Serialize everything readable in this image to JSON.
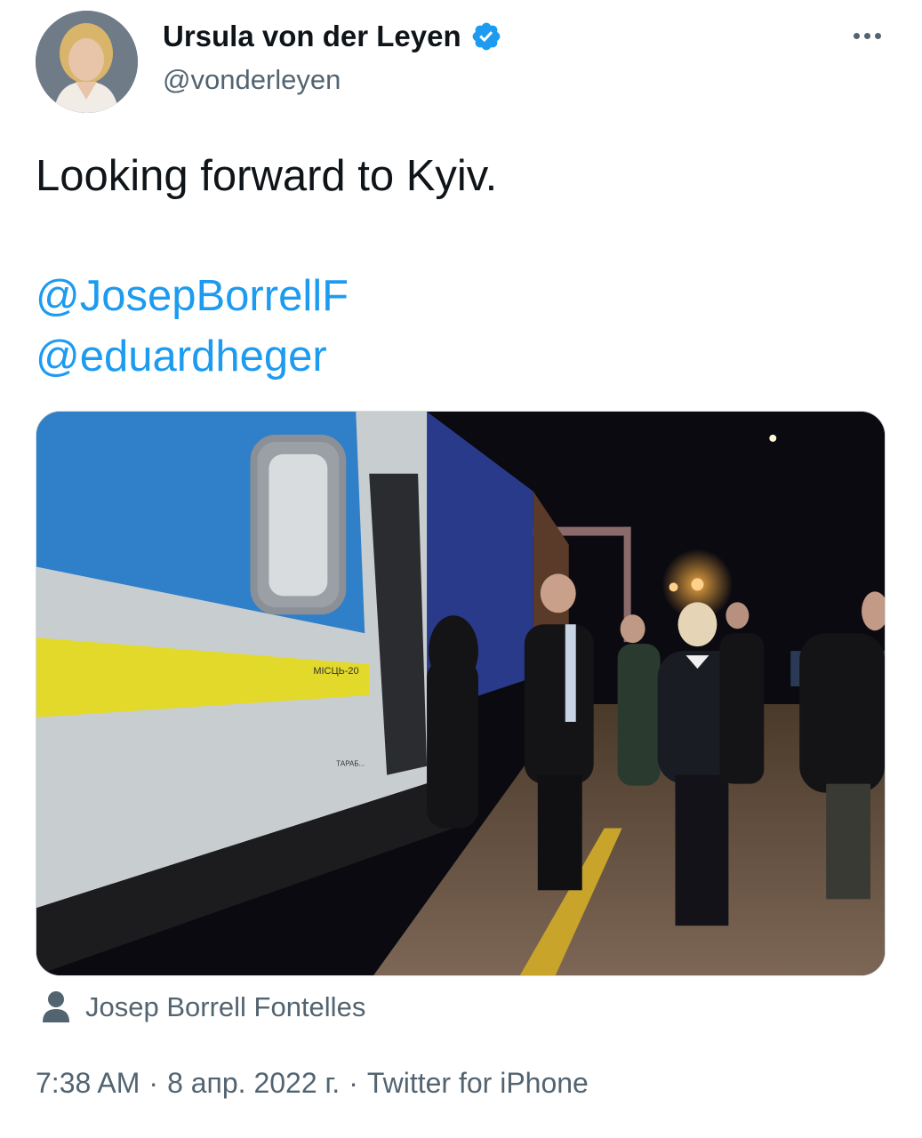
{
  "author": {
    "display_name": "Ursula von der Leyen",
    "handle": "@vonderleyen",
    "verified_icon": "verified-badge",
    "verified_color": "#1d9bf0"
  },
  "menu_icon": "more-horizontal-icon",
  "tweet": {
    "text": "Looking forward to Kyiv.",
    "mentions": [
      "@JosepBorrellF",
      "@eduardheger"
    ],
    "link_color": "#1d9bf0"
  },
  "media": {
    "photo_credit": "Josep Borrell Fontelles",
    "credit_icon": "person-icon",
    "car_label": "МІСЦЬ-20",
    "car_sub_label": "ТАРАБ..."
  },
  "meta": {
    "time": "7:38 AM",
    "date": "8 апр. 2022 г.",
    "separator": "·",
    "source": "Twitter for iPhone"
  }
}
